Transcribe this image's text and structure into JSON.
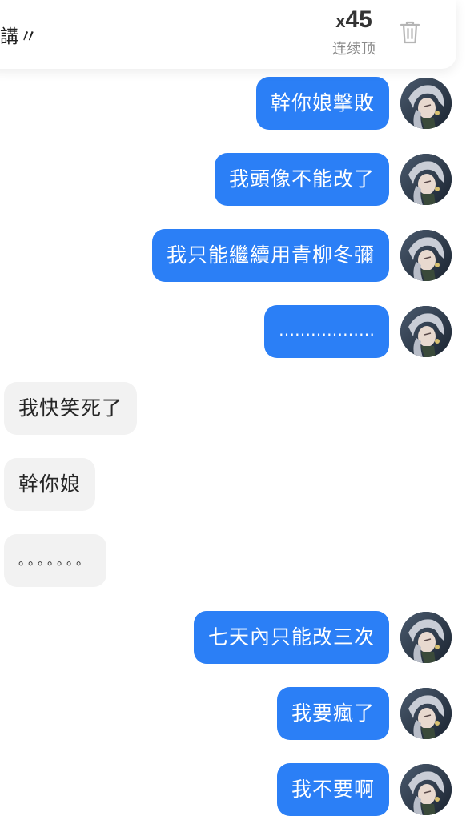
{
  "top_bar": {
    "partial_text": "講〃",
    "counter_prefix": "x",
    "counter_value": "45",
    "counter_label": "连续顶",
    "trash_icon": "trash-icon"
  },
  "messages": [
    {
      "direction": "outgoing",
      "text": "幹你娘擊敗"
    },
    {
      "direction": "outgoing",
      "text": "我頭像不能改了"
    },
    {
      "direction": "outgoing",
      "text": "我只能繼續用青柳冬彌"
    },
    {
      "direction": "outgoing",
      "text": "………………"
    },
    {
      "direction": "incoming",
      "text": "我快笑死了"
    },
    {
      "direction": "incoming",
      "text": "幹你娘"
    },
    {
      "direction": "incoming",
      "text": "。。。。。。。"
    },
    {
      "direction": "outgoing",
      "text": "七天內只能改三次"
    },
    {
      "direction": "outgoing",
      "text": "我要瘋了"
    },
    {
      "direction": "outgoing",
      "text": "我不要啊"
    }
  ],
  "colors": {
    "outgoing_bubble": "#2b7ff6",
    "incoming_bubble": "#f2f2f2",
    "counter_text": "#333333",
    "counter_label": "#8a8a8a"
  },
  "avatar_icon": "user-avatar-icon"
}
